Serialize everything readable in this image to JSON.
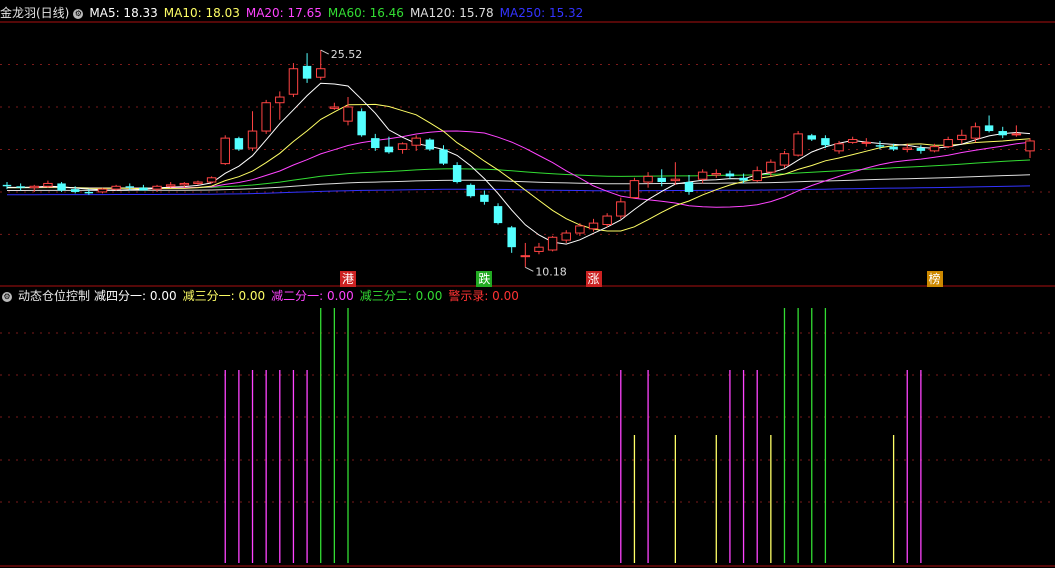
{
  "header": {
    "title": "金龙羽(日线)",
    "ma": [
      {
        "label": "MA5: 18.33",
        "color": "#ffffff"
      },
      {
        "label": "MA10: 18.03",
        "color": "#ffff66"
      },
      {
        "label": "MA20: 17.65",
        "color": "#ff44ff"
      },
      {
        "label": "MA60: 16.46",
        "color": "#33dd33"
      },
      {
        "label": "MA120: 15.78",
        "color": "#dddddd"
      },
      {
        "label": "MA250: 15.32",
        "color": "#3333ff"
      }
    ]
  },
  "sub_header": {
    "title": "动态仓位控制",
    "items": [
      {
        "label": "减四分一: 0.00",
        "color": "#ffffff"
      },
      {
        "label": "减三分一: 0.00",
        "color": "#ffff66"
      },
      {
        "label": "减二分一: 0.00",
        "color": "#ff44ff"
      },
      {
        "label": "减三分二: 0.00",
        "color": "#33dd33"
      },
      {
        "label": "警示录: 0.00",
        "color": "#ff3333"
      }
    ]
  },
  "annotations": {
    "high": "25.52",
    "low": "10.18"
  },
  "badges": [
    {
      "text": "港",
      "bg": "#cc2222",
      "fg": "#ffffff",
      "bar": 25
    },
    {
      "text": "跌",
      "bg": "#22aa22",
      "fg": "#ffffff",
      "bar": 35
    },
    {
      "text": "涨",
      "bg": "#cc2222",
      "fg": "#ffffff",
      "bar": 43
    },
    {
      "text": "榜",
      "bg": "#cc8800",
      "fg": "#ffffff",
      "bar": 68
    }
  ],
  "chart_data": {
    "type": "candlestick",
    "series_candles": [
      [
        16.0,
        16.2,
        15.7,
        15.9
      ],
      [
        15.9,
        16.1,
        15.6,
        15.8
      ],
      [
        15.8,
        16.0,
        15.5,
        15.9
      ],
      [
        15.9,
        16.3,
        15.8,
        16.1
      ],
      [
        16.1,
        16.2,
        15.5,
        15.6
      ],
      [
        15.7,
        15.9,
        15.4,
        15.5
      ],
      [
        15.5,
        15.7,
        15.3,
        15.4
      ],
      [
        15.5,
        15.8,
        15.4,
        15.7
      ],
      [
        15.7,
        16.0,
        15.6,
        15.9
      ],
      [
        15.9,
        16.1,
        15.6,
        15.8
      ],
      [
        15.8,
        16.0,
        15.6,
        15.6
      ],
      [
        15.7,
        16.0,
        15.5,
        15.9
      ],
      [
        15.9,
        16.2,
        15.8,
        16.0
      ],
      [
        16.0,
        16.2,
        15.8,
        16.1
      ],
      [
        16.1,
        16.3,
        16.0,
        16.2
      ],
      [
        16.2,
        16.6,
        16.1,
        16.5
      ],
      [
        17.5,
        19.5,
        17.4,
        19.3
      ],
      [
        19.3,
        19.4,
        18.4,
        18.5
      ],
      [
        18.6,
        21.2,
        18.4,
        19.8
      ],
      [
        19.8,
        22.0,
        19.6,
        21.8
      ],
      [
        21.8,
        22.6,
        20.6,
        22.2
      ],
      [
        22.4,
        24.6,
        22.2,
        24.2
      ],
      [
        24.4,
        25.3,
        23.2,
        23.5
      ],
      [
        23.6,
        25.52,
        23.4,
        24.2
      ],
      [
        21.4,
        21.8,
        21.3,
        21.5
      ],
      [
        20.5,
        22.2,
        20.2,
        21.5
      ],
      [
        21.2,
        21.4,
        19.4,
        19.5
      ],
      [
        19.3,
        19.6,
        18.4,
        18.6
      ],
      [
        18.7,
        19.4,
        18.2,
        18.3
      ],
      [
        18.5,
        19.0,
        18.2,
        18.9
      ],
      [
        18.8,
        19.5,
        18.4,
        19.3
      ],
      [
        19.2,
        19.3,
        18.4,
        18.5
      ],
      [
        18.5,
        18.8,
        17.4,
        17.5
      ],
      [
        17.4,
        17.6,
        16.1,
        16.2
      ],
      [
        16.0,
        16.1,
        15.1,
        15.2
      ],
      [
        15.3,
        15.6,
        14.6,
        14.8
      ],
      [
        14.5,
        14.7,
        13.2,
        13.3
      ],
      [
        13.0,
        13.1,
        11.2,
        11.6
      ],
      [
        11.0,
        11.9,
        10.18,
        11.0
      ],
      [
        11.3,
        11.9,
        11.1,
        11.6
      ],
      [
        11.4,
        12.4,
        11.3,
        12.3
      ],
      [
        12.1,
        12.8,
        11.9,
        12.6
      ],
      [
        12.6,
        13.3,
        12.4,
        13.1
      ],
      [
        12.9,
        13.6,
        12.7,
        13.3
      ],
      [
        13.2,
        14.0,
        13.0,
        13.8
      ],
      [
        13.8,
        15.1,
        13.6,
        14.8
      ],
      [
        15.1,
        16.5,
        15.0,
        16.3
      ],
      [
        16.2,
        16.9,
        15.8,
        16.6
      ],
      [
        16.5,
        17.1,
        15.9,
        16.2
      ],
      [
        16.3,
        17.6,
        16.0,
        16.4
      ],
      [
        16.2,
        16.7,
        15.3,
        15.5
      ],
      [
        16.4,
        17.1,
        16.1,
        16.9
      ],
      [
        16.7,
        17.1,
        16.5,
        16.8
      ],
      [
        16.8,
        17.0,
        16.4,
        16.6
      ],
      [
        16.5,
        16.8,
        16.1,
        16.3
      ],
      [
        16.3,
        17.3,
        16.2,
        17.0
      ],
      [
        16.9,
        17.8,
        16.6,
        17.6
      ],
      [
        17.4,
        18.4,
        17.2,
        18.2
      ],
      [
        18.1,
        19.8,
        18.0,
        19.6
      ],
      [
        19.5,
        19.6,
        19.1,
        19.2
      ],
      [
        19.3,
        19.5,
        18.6,
        18.8
      ],
      [
        18.4,
        19.1,
        18.2,
        18.9
      ],
      [
        19.0,
        19.4,
        18.9,
        19.2
      ],
      [
        19.0,
        19.3,
        18.7,
        19.0
      ],
      [
        18.8,
        19.1,
        18.5,
        18.7
      ],
      [
        18.7,
        18.9,
        18.4,
        18.5
      ],
      [
        18.5,
        18.9,
        18.3,
        18.6
      ],
      [
        18.6,
        18.8,
        18.2,
        18.4
      ],
      [
        18.4,
        18.9,
        18.3,
        18.7
      ],
      [
        18.7,
        19.4,
        18.6,
        19.2
      ],
      [
        19.2,
        19.9,
        18.9,
        19.5
      ],
      [
        19.3,
        20.4,
        19.0,
        20.1
      ],
      [
        20.2,
        20.9,
        19.7,
        19.8
      ],
      [
        19.8,
        20.1,
        19.3,
        19.5
      ],
      [
        19.6,
        20.2,
        19.4,
        19.6
      ],
      [
        18.4,
        19.3,
        17.9,
        19.1
      ]
    ],
    "ma_values": {
      "MA5": 18.33,
      "MA10": 18.03,
      "MA20": 17.65,
      "MA60": 16.46,
      "MA120": 15.78,
      "MA250": 15.32
    },
    "high_label": 25.52,
    "low_label": 10.18,
    "ylim": [
      9.0,
      27.5
    ],
    "indicator": {
      "name": "动态仓位控制",
      "signals": [
        {
          "bar": 16,
          "type": "magenta"
        },
        {
          "bar": 17,
          "type": "magenta"
        },
        {
          "bar": 18,
          "type": "magenta"
        },
        {
          "bar": 19,
          "type": "magenta"
        },
        {
          "bar": 20,
          "type": "magenta"
        },
        {
          "bar": 21,
          "type": "magenta"
        },
        {
          "bar": 22,
          "type": "magenta"
        },
        {
          "bar": 23,
          "type": "green"
        },
        {
          "bar": 24,
          "type": "green"
        },
        {
          "bar": 25,
          "type": "green"
        },
        {
          "bar": 45,
          "type": "magenta"
        },
        {
          "bar": 46,
          "type": "yellow"
        },
        {
          "bar": 47,
          "type": "magenta"
        },
        {
          "bar": 49,
          "type": "yellow"
        },
        {
          "bar": 52,
          "type": "yellow"
        },
        {
          "bar": 53,
          "type": "magenta"
        },
        {
          "bar": 54,
          "type": "magenta"
        },
        {
          "bar": 55,
          "type": "magenta"
        },
        {
          "bar": 56,
          "type": "yellow"
        },
        {
          "bar": 57,
          "type": "green"
        },
        {
          "bar": 58,
          "type": "green"
        },
        {
          "bar": 59,
          "type": "green"
        },
        {
          "bar": 60,
          "type": "green"
        },
        {
          "bar": 65,
          "type": "yellow"
        },
        {
          "bar": 66,
          "type": "magenta"
        },
        {
          "bar": 67,
          "type": "magenta"
        }
      ],
      "levels": {
        "magenta": 0.5,
        "yellow": 0.33,
        "green": 0.75
      }
    }
  }
}
